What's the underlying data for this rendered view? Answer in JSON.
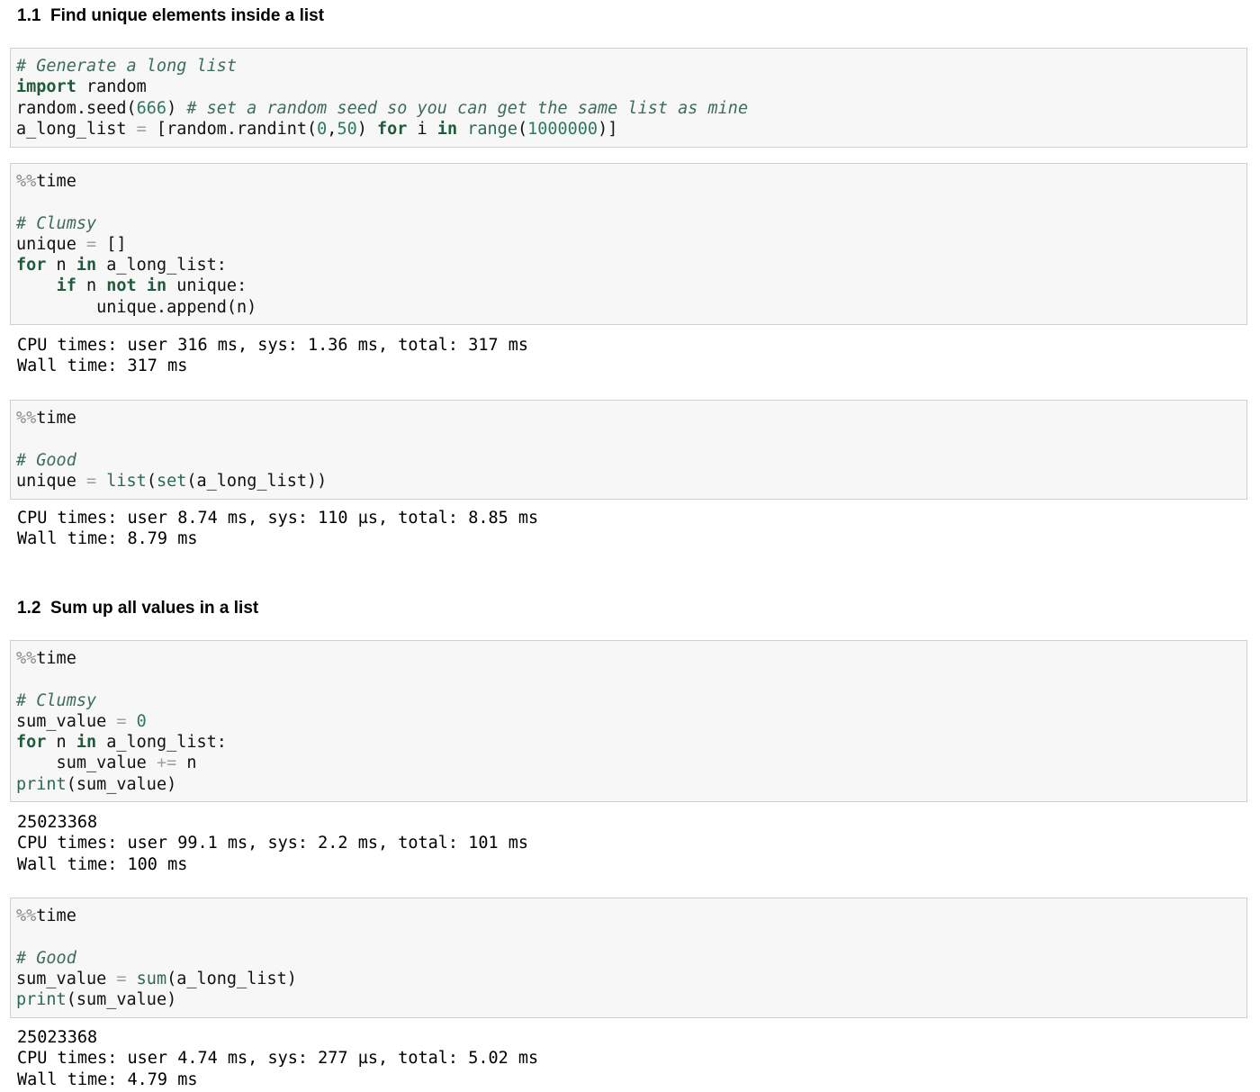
{
  "section_1": {
    "heading": "1.1  Find unique elements inside a list",
    "cells": [
      {
        "lines": [
          [
            {
              "t": "# Generate a long list",
              "c": "cm"
            }
          ],
          [
            {
              "t": "import",
              "c": "kw"
            },
            {
              "t": " random",
              "c": "pl"
            }
          ],
          [
            {
              "t": "random.seed(",
              "c": "pl"
            },
            {
              "t": "666",
              "c": "num"
            },
            {
              "t": ") ",
              "c": "pl"
            },
            {
              "t": "# set a random seed so you can get the same list as mine",
              "c": "cm"
            }
          ],
          [
            {
              "t": "a_long_list ",
              "c": "pl"
            },
            {
              "t": "=",
              "c": "op"
            },
            {
              "t": " [random.randint(",
              "c": "pl"
            },
            {
              "t": "0",
              "c": "num"
            },
            {
              "t": ",",
              "c": "pl"
            },
            {
              "t": "50",
              "c": "num"
            },
            {
              "t": ") ",
              "c": "pl"
            },
            {
              "t": "for",
              "c": "kw"
            },
            {
              "t": " i ",
              "c": "pl"
            },
            {
              "t": "in",
              "c": "kw"
            },
            {
              "t": " ",
              "c": "pl"
            },
            {
              "t": "range",
              "c": "bi"
            },
            {
              "t": "(",
              "c": "pl"
            },
            {
              "t": "1000000",
              "c": "num"
            },
            {
              "t": ")]",
              "c": "pl"
            }
          ]
        ],
        "output": []
      },
      {
        "lines": [
          [
            {
              "t": "%%",
              "c": "mg"
            },
            {
              "t": "time",
              "c": "pl"
            }
          ],
          [],
          [
            {
              "t": "# Clumsy",
              "c": "cm"
            }
          ],
          [
            {
              "t": "unique ",
              "c": "pl"
            },
            {
              "t": "=",
              "c": "op"
            },
            {
              "t": " []",
              "c": "pl"
            }
          ],
          [
            {
              "t": "for",
              "c": "kw"
            },
            {
              "t": " n ",
              "c": "pl"
            },
            {
              "t": "in",
              "c": "kw"
            },
            {
              "t": " a_long_list:",
              "c": "pl"
            }
          ],
          [
            {
              "t": "    ",
              "c": "pl"
            },
            {
              "t": "if",
              "c": "kw"
            },
            {
              "t": " n ",
              "c": "pl"
            },
            {
              "t": "not",
              "c": "kw"
            },
            {
              "t": " ",
              "c": "pl"
            },
            {
              "t": "in",
              "c": "kw"
            },
            {
              "t": " unique:",
              "c": "pl"
            }
          ],
          [
            {
              "t": "        unique.append(n)",
              "c": "pl"
            }
          ]
        ],
        "output": [
          "CPU times: user 316 ms, sys: 1.36 ms, total: 317 ms",
          "Wall time: 317 ms"
        ]
      },
      {
        "lines": [
          [
            {
              "t": "%%",
              "c": "mg"
            },
            {
              "t": "time",
              "c": "pl"
            }
          ],
          [],
          [
            {
              "t": "# Good",
              "c": "cm"
            }
          ],
          [
            {
              "t": "unique ",
              "c": "pl"
            },
            {
              "t": "=",
              "c": "op"
            },
            {
              "t": " ",
              "c": "pl"
            },
            {
              "t": "list",
              "c": "bi"
            },
            {
              "t": "(",
              "c": "pl"
            },
            {
              "t": "set",
              "c": "bi"
            },
            {
              "t": "(a_long_list))",
              "c": "pl"
            }
          ]
        ],
        "output": [
          "CPU times: user 8.74 ms, sys: 110 µs, total: 8.85 ms",
          "Wall time: 8.79 ms"
        ]
      }
    ]
  },
  "section_2": {
    "heading": "1.2  Sum up all values in a list",
    "cells": [
      {
        "lines": [
          [
            {
              "t": "%%",
              "c": "mg"
            },
            {
              "t": "time",
              "c": "pl"
            }
          ],
          [],
          [
            {
              "t": "# Clumsy",
              "c": "cm"
            }
          ],
          [
            {
              "t": "sum_value ",
              "c": "pl"
            },
            {
              "t": "=",
              "c": "op"
            },
            {
              "t": " ",
              "c": "pl"
            },
            {
              "t": "0",
              "c": "num"
            }
          ],
          [
            {
              "t": "for",
              "c": "kw"
            },
            {
              "t": " n ",
              "c": "pl"
            },
            {
              "t": "in",
              "c": "kw"
            },
            {
              "t": " a_long_list:",
              "c": "pl"
            }
          ],
          [
            {
              "t": "    sum_value ",
              "c": "pl"
            },
            {
              "t": "+=",
              "c": "op"
            },
            {
              "t": " n",
              "c": "pl"
            }
          ],
          [
            {
              "t": "print",
              "c": "bi"
            },
            {
              "t": "(sum_value)",
              "c": "pl"
            }
          ]
        ],
        "output": [
          "25023368",
          "CPU times: user 99.1 ms, sys: 2.2 ms, total: 101 ms",
          "Wall time: 100 ms"
        ]
      },
      {
        "lines": [
          [
            {
              "t": "%%",
              "c": "mg"
            },
            {
              "t": "time",
              "c": "pl"
            }
          ],
          [],
          [
            {
              "t": "# Good",
              "c": "cm"
            }
          ],
          [
            {
              "t": "sum_value ",
              "c": "pl"
            },
            {
              "t": "=",
              "c": "op"
            },
            {
              "t": " ",
              "c": "pl"
            },
            {
              "t": "sum",
              "c": "bi"
            },
            {
              "t": "(a_long_list)",
              "c": "pl"
            }
          ],
          [
            {
              "t": "print",
              "c": "bi"
            },
            {
              "t": "(sum_value)",
              "c": "pl"
            }
          ]
        ],
        "output": [
          "25023368",
          "CPU times: user 4.74 ms, sys: 277 µs, total: 5.02 ms",
          "Wall time: 4.79 ms"
        ]
      }
    ]
  }
}
